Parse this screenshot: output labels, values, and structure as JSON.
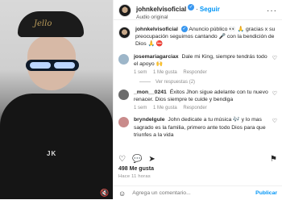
{
  "post_header": {
    "username": "johnkelvisoficial",
    "audio": "Audio original",
    "follow_label": "Seguir",
    "more_icon": "ellipsis-icon"
  },
  "caption": {
    "username": "johnkelvisoficial",
    "text": "Anuncio público 👀 🙏 gracias x su preocupación seguimos cantando 🎤 con la bendición de Dios 🙏 ⛔"
  },
  "comments": [
    {
      "username": "josemariagarciax",
      "text": "Dale mi King, siempre tendrás todo el apoyo 🙌",
      "time": "1 sem",
      "likes": "1 Me gusta",
      "reply": "Responder",
      "replies_label": "Ver respuestas (2)",
      "avatar_color": "#9db6c9"
    },
    {
      "username": "_mon__0241",
      "text": "Éxitos Jhon sigue adelante con tu nuevo renacer. Dios siempre te cuide y bendiga",
      "time": "1 sem",
      "likes": "1 Me gusta",
      "reply": "Responder",
      "avatar_color": "#6b6b6b"
    },
    {
      "username": "bryndelgule",
      "text": "John dedicate a tu música 🎶 y lo mas sagrado es la familia, primero ante todo Dios para que triunfes a la vida",
      "time": "",
      "likes": "",
      "reply": "",
      "avatar_color": "#c98b8b"
    }
  ],
  "stats": {
    "likes": "498 Me gusta",
    "time": "Hace 11 horas"
  },
  "comment_bar": {
    "placeholder": "Agrega un comentario...",
    "post_label": "Publicar"
  },
  "media": {
    "cap_text": "Jello",
    "jacket_text": "JK"
  }
}
